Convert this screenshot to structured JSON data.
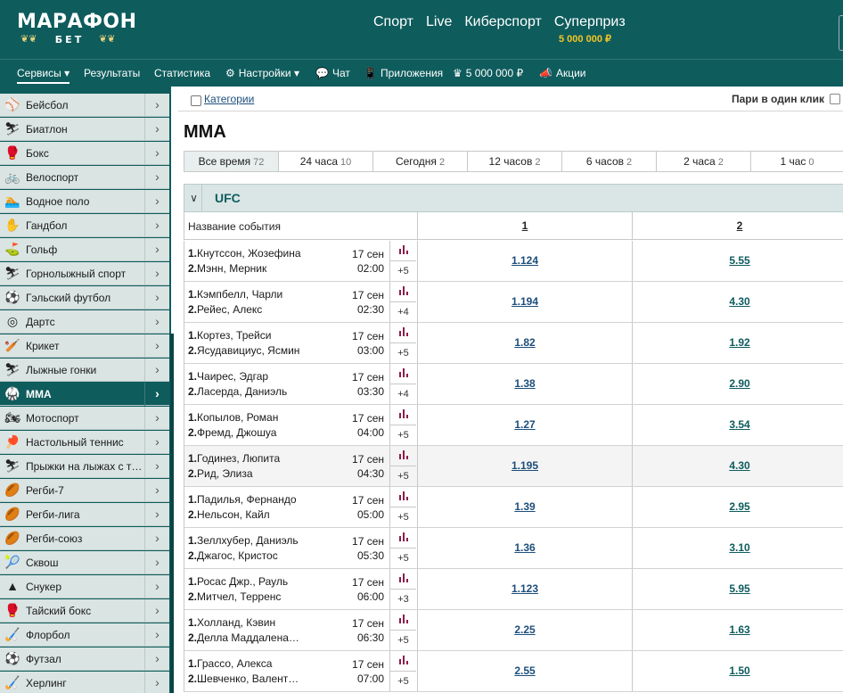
{
  "header": {
    "logo_main": "МАРАФОН",
    "logo_sub": "БЕТ",
    "nav": [
      "Спорт",
      "Live",
      "Киберспорт",
      "Суперприз"
    ],
    "jackpot": "5 000 000 ₽"
  },
  "subnav": {
    "services": "Сервисы",
    "results": "Результаты",
    "stats": "Статистика",
    "settings": "Настройки",
    "chat": "Чат",
    "apps": "Приложения",
    "jackpot": "5 000 000 ₽",
    "promos": "Акции"
  },
  "sidebar": {
    "items": [
      {
        "name": "Бейсбол",
        "icon": "⚾"
      },
      {
        "name": "Биатлон",
        "icon": "⛷"
      },
      {
        "name": "Бокс",
        "icon": "🥊"
      },
      {
        "name": "Велоспорт",
        "icon": "🚲"
      },
      {
        "name": "Водное поло",
        "icon": "🏊"
      },
      {
        "name": "Гандбол",
        "icon": "✋"
      },
      {
        "name": "Гольф",
        "icon": "⛳"
      },
      {
        "name": "Горнолыжный спорт",
        "icon": "⛷"
      },
      {
        "name": "Гэльский футбол",
        "icon": "⚽"
      },
      {
        "name": "Дартс",
        "icon": "◎"
      },
      {
        "name": "Крикет",
        "icon": "🏏"
      },
      {
        "name": "Лыжные гонки",
        "icon": "⛷"
      },
      {
        "name": "ММА",
        "icon": "🥋",
        "active": true
      },
      {
        "name": "Мотоспорт",
        "icon": "🏍"
      },
      {
        "name": "Настольный теннис",
        "icon": "🏓"
      },
      {
        "name": "Прыжки на лыжах с т…",
        "icon": "⛷"
      },
      {
        "name": "Регби-7",
        "icon": "🏉"
      },
      {
        "name": "Регби-лига",
        "icon": "🏉"
      },
      {
        "name": "Регби-союз",
        "icon": "🏉"
      },
      {
        "name": "Сквош",
        "icon": "🎾"
      },
      {
        "name": "Снукер",
        "icon": "▲"
      },
      {
        "name": "Тайский бокс",
        "icon": "🥊"
      },
      {
        "name": "Флорбол",
        "icon": "🏑"
      },
      {
        "name": "Футзал",
        "icon": "⚽"
      },
      {
        "name": "Херлинг",
        "icon": "🏑"
      }
    ]
  },
  "main": {
    "categories": "Категории",
    "one_click": "Пари в один клик",
    "title": "ММА",
    "tabs": [
      {
        "label": "Все время",
        "count": "72"
      },
      {
        "label": "24 часа",
        "count": "10"
      },
      {
        "label": "Сегодня",
        "count": "2"
      },
      {
        "label": "12 часов",
        "count": "2"
      },
      {
        "label": "6 часов",
        "count": "2"
      },
      {
        "label": "2 часа",
        "count": "2"
      },
      {
        "label": "1 час",
        "count": "0"
      }
    ],
    "league": "UFC",
    "col_event": "Название события",
    "col_1": "1",
    "col_2": "2",
    "events": [
      {
        "p1": "Кнутссон, Жозефина",
        "p2": "Мэнн, Мерник",
        "date": "17 сен",
        "time": "02:00",
        "more": "+5",
        "o1": "1.124",
        "o2": "5.55"
      },
      {
        "p1": "Кэмпбелл, Чарли",
        "p2": "Рейес, Алекс",
        "date": "17 сен",
        "time": "02:30",
        "more": "+4",
        "o1": "1.194",
        "o2": "4.30"
      },
      {
        "p1": "Кортез, Трейси",
        "p2": "Ясудавициус, Ясмин",
        "date": "17 сен",
        "time": "03:00",
        "more": "+5",
        "o1": "1.82",
        "o2": "1.92"
      },
      {
        "p1": "Чаирес, Эдгар",
        "p2": "Ласерда, Даниэль",
        "date": "17 сен",
        "time": "03:30",
        "more": "+4",
        "o1": "1.38",
        "o2": "2.90"
      },
      {
        "p1": "Копылов, Роман",
        "p2": "Фремд, Джошуа",
        "date": "17 сен",
        "time": "04:00",
        "more": "+5",
        "o1": "1.27",
        "o2": "3.54"
      },
      {
        "p1": "Годинез, Люпита",
        "p2": "Рид, Элиза",
        "date": "17 сен",
        "time": "04:30",
        "more": "+5",
        "o1": "1.195",
        "o2": "4.30"
      },
      {
        "p1": "Падилья, Фернандо",
        "p2": "Нельсон, Кайл",
        "date": "17 сен",
        "time": "05:00",
        "more": "+5",
        "o1": "1.39",
        "o2": "2.95"
      },
      {
        "p1": "Зеллхубер, Даниэль",
        "p2": "Джагос, Кристос",
        "date": "17 сен",
        "time": "05:30",
        "more": "+5",
        "o1": "1.36",
        "o2": "3.10"
      },
      {
        "p1": "Росас Джр., Рауль",
        "p2": "Митчел, Терренс",
        "date": "17 сен",
        "time": "06:00",
        "more": "+3",
        "o1": "1.123",
        "o2": "5.95"
      },
      {
        "p1": "Холланд, Кэвин",
        "p2": "Делла Маддалена…",
        "date": "17 сен",
        "time": "06:30",
        "more": "+5",
        "o1": "2.25",
        "o2": "1.63"
      },
      {
        "p1": "Грассо, Алекса",
        "p2": "Шевченко, Валент…",
        "date": "17 сен",
        "time": "07:00",
        "more": "+5",
        "o1": "2.55",
        "o2": "1.50"
      }
    ]
  }
}
